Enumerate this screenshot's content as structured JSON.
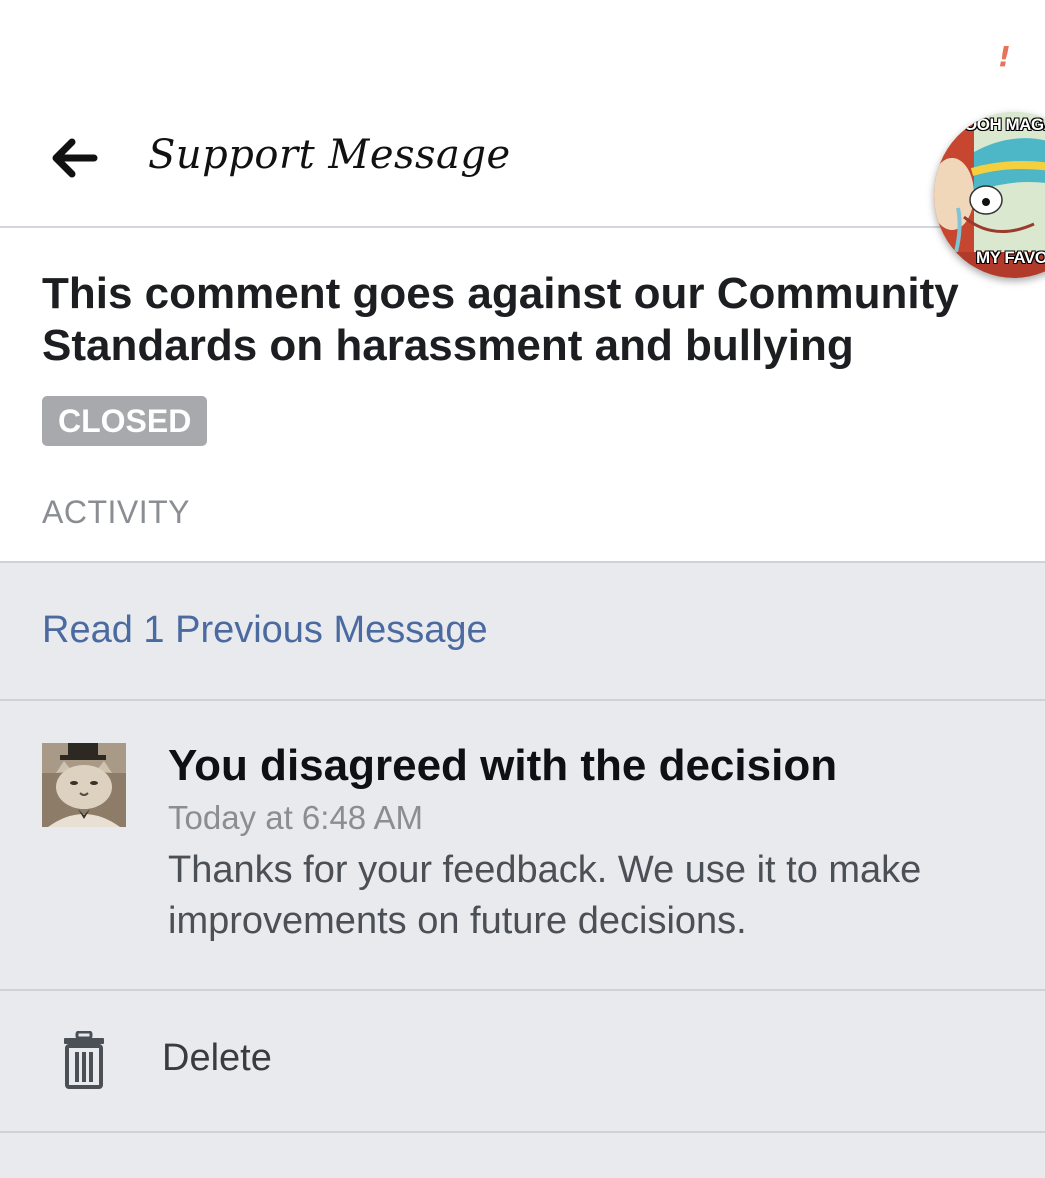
{
  "status_bar": {
    "alert_glyph": "!"
  },
  "header": {
    "back_icon": "arrow-left-icon",
    "title": "Support Message"
  },
  "chat_head": {
    "caption_top": "OOH MAGA",
    "caption_bottom": "MY FAVOI"
  },
  "case": {
    "title": "This comment goes against our Community Standards on harassment and bullying",
    "status_badge": "CLOSED",
    "section_label": "ACTIVITY"
  },
  "activity": {
    "previous_link": "Read 1 Previous Message",
    "message": {
      "title": "You disagreed with the decision",
      "time": "Today at 6:48 AM",
      "body": "Thanks for your feedback. We use it to make improvements on future decisions."
    },
    "delete_label": "Delete",
    "delete_icon": "trash-icon"
  },
  "colors": {
    "link": "#4b6aa0",
    "badge": "#a8a9ad",
    "gray_background": "#e9eaee",
    "alert": "#e8735a"
  }
}
